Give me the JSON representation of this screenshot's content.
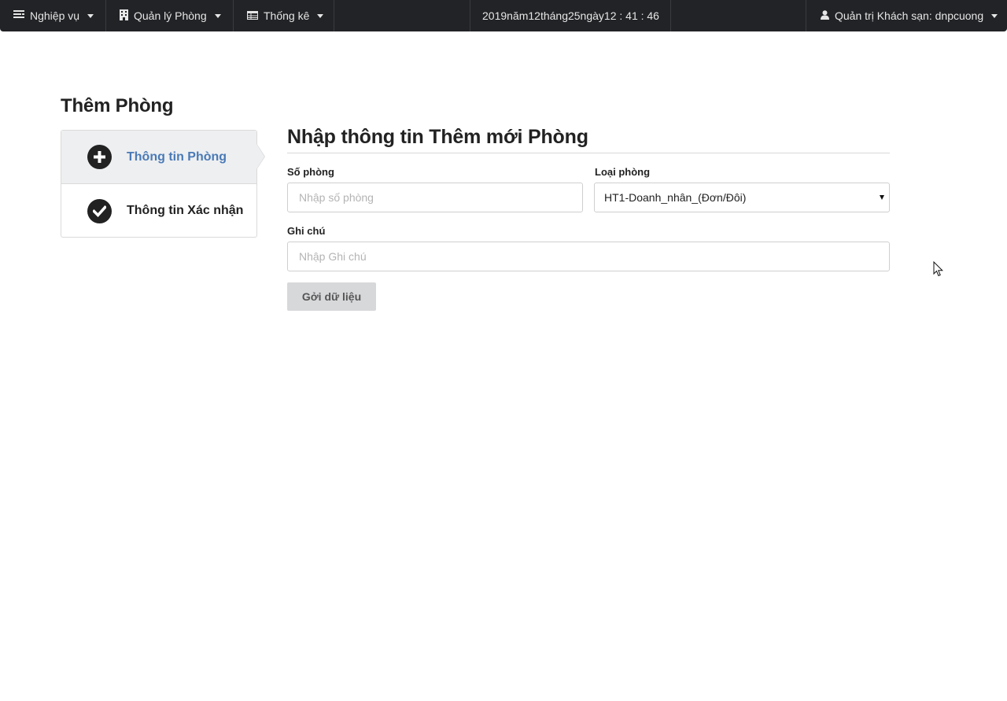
{
  "navbar": {
    "nghiepvu": {
      "label": "Nghiệp vụ",
      "icon": "list-icon"
    },
    "quanly": {
      "label": "Quản lý Phòng",
      "icon": "building-icon"
    },
    "thongke": {
      "label": "Thống kê",
      "icon": "table-icon"
    },
    "clock": "2019năm12tháng25ngày12 : 41 : 46",
    "user": {
      "label": "Quản trị Khách sạn: dnpcuong",
      "icon": "user-icon"
    }
  },
  "page": {
    "title": "Thêm Phòng"
  },
  "steps": [
    {
      "label": "Thông tin Phòng",
      "icon": "plus-circle-icon",
      "state": "active"
    },
    {
      "label": "Thông tin Xác nhận",
      "icon": "check-circle-icon",
      "state": "inactive"
    }
  ],
  "form": {
    "title": "Nhập thông tin Thêm mới Phòng",
    "so_phong": {
      "label": "Số phòng",
      "placeholder": "Nhập số phòng",
      "value": ""
    },
    "loai_phong": {
      "label": "Loại phòng",
      "selected": "HT1-Doanh_nhân_(Đơn/Đôi)"
    },
    "ghi_chu": {
      "label": "Ghi chú",
      "placeholder": "Nhập Ghi chú",
      "value": ""
    },
    "submit_label": "Gởi dữ liệu"
  },
  "colors": {
    "navbar_bg": "#222326",
    "active_step_text": "#4a7ab6",
    "active_step_bg": "#eeeff1",
    "button_bg": "#d7d8da"
  }
}
